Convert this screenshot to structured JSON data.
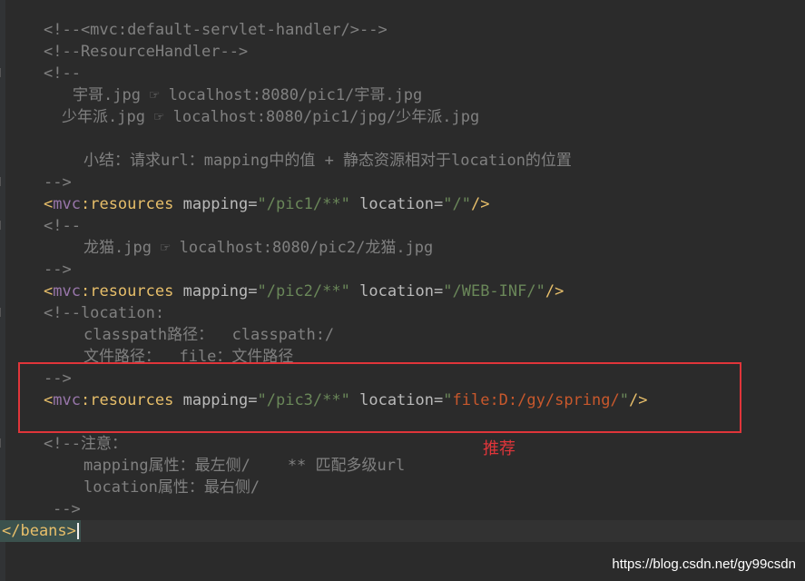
{
  "lines": {
    "l1": "<!--<mvc:default-servlet-handler/>-->",
    "l2": "<!--ResourceHandler-->",
    "l3": "<!--",
    "l4": "宇哥.jpg ☞ localhost:8080/pic1/宇哥.jpg",
    "l5": "少年派.jpg ☞ localhost:8080/pic1/jpg/少年派.jpg",
    "l6": "小结：请求url：mapping中的值 + 静态资源相对于location的位置",
    "l7": "-->",
    "l9": "<!--",
    "l10": "龙猫.jpg ☞ localhost:8080/pic2/龙猫.jpg",
    "l11": "-->",
    "l13": "<!--location:",
    "l14": "classpath路径：  classpath:/",
    "l15": "文件路径：  file：文件路径",
    "l16": "-->",
    "l18": "<!--注意：",
    "l19": "mapping属性：最左侧/    ** 匹配多级url",
    "l20": "location属性：最右侧/",
    "l21": "-->"
  },
  "resources": [
    {
      "mapping": "\"/pic1/**\"",
      "location": "\"/\""
    },
    {
      "mapping": "\"/pic2/**\"",
      "location": "\"/WEB-INF/\""
    },
    {
      "mapping": "\"/pic3/**\"",
      "location_open": "\"",
      "location_value": "file:D:/gy/spring/",
      "location_close": "\""
    }
  ],
  "syntax": {
    "open": "<",
    "ns": "mvc",
    "colon": ":",
    "tag": "resources",
    "attr_mapping": "mapping",
    "attr_location": "location",
    "eq": "=",
    "selfclose": "/>"
  },
  "closing_tag": "</beans>",
  "annotation": "推荐",
  "watermark": "https://blog.csdn.net/gy99csdn",
  "colors": {
    "background": "#2b2b2b",
    "comment": "#808080",
    "tag": "#e8bf6a",
    "string": "#6a8759",
    "highlight_box": "#e0353a"
  }
}
